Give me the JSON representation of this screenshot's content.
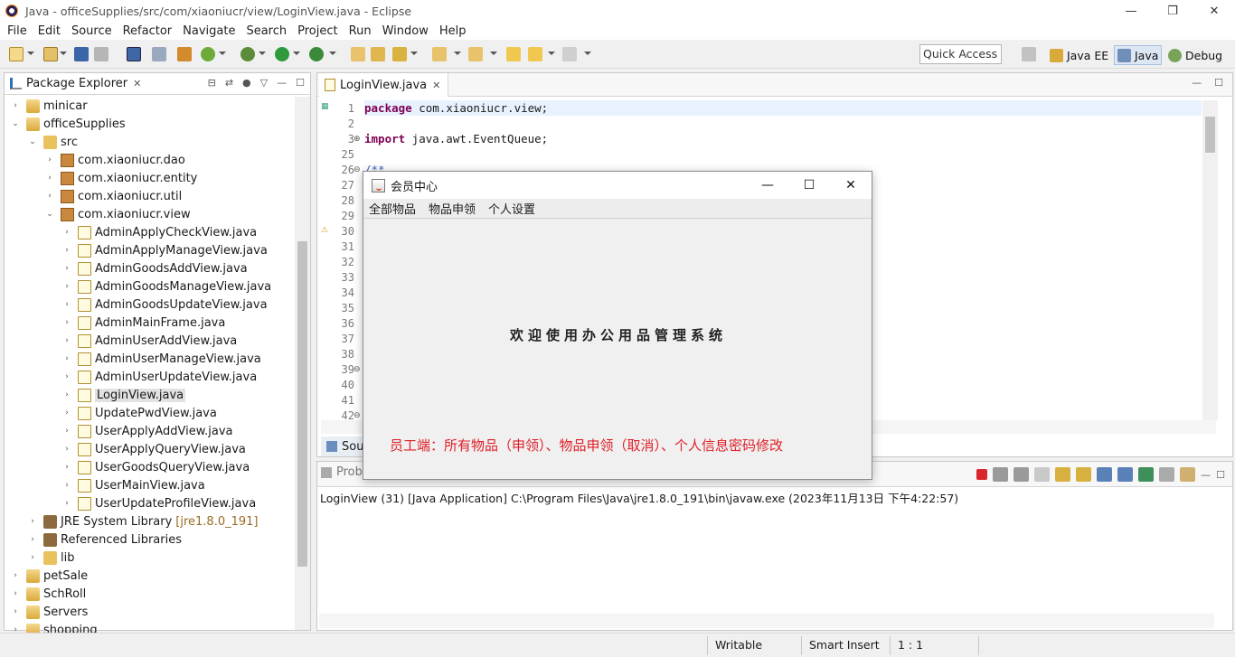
{
  "window": {
    "title": "Java - officeSupplies/src/com/xiaoniucr/view/LoginView.java - Eclipse",
    "minimize": "—",
    "restore": "❐",
    "close": "✕"
  },
  "menu": [
    "File",
    "Edit",
    "Source",
    "Refactor",
    "Navigate",
    "Search",
    "Project",
    "Run",
    "Window",
    "Help"
  ],
  "quick_access": "Quick Access",
  "perspectives": [
    {
      "label": "Java EE",
      "active": false
    },
    {
      "label": "Java",
      "active": true
    },
    {
      "label": "Debug",
      "active": false
    }
  ],
  "package_explorer": {
    "tab_label": "Package Explorer",
    "tree": [
      {
        "label": "minicar",
        "type": "project",
        "level": 0,
        "expanded": false
      },
      {
        "label": "officeSupplies",
        "type": "project",
        "level": 0,
        "expanded": true
      },
      {
        "label": "src",
        "type": "folder",
        "level": 1,
        "expanded": true
      },
      {
        "label": "com.xiaoniucr.dao",
        "type": "pkg",
        "level": 2,
        "expanded": false
      },
      {
        "label": "com.xiaoniucr.entity",
        "type": "pkg",
        "level": 2,
        "expanded": false
      },
      {
        "label": "com.xiaoniucr.util",
        "type": "pkg",
        "level": 2,
        "expanded": false
      },
      {
        "label": "com.xiaoniucr.view",
        "type": "pkg",
        "level": 2,
        "expanded": true
      },
      {
        "label": "AdminApplyCheckView.java",
        "type": "java",
        "level": 3,
        "expanded": false
      },
      {
        "label": "AdminApplyManageView.java",
        "type": "java",
        "level": 3,
        "expanded": false
      },
      {
        "label": "AdminGoodsAddView.java",
        "type": "java",
        "level": 3,
        "expanded": false
      },
      {
        "label": "AdminGoodsManageView.java",
        "type": "java",
        "level": 3,
        "expanded": false
      },
      {
        "label": "AdminGoodsUpdateView.java",
        "type": "java",
        "level": 3,
        "expanded": false
      },
      {
        "label": "AdminMainFrame.java",
        "type": "java",
        "level": 3,
        "expanded": false
      },
      {
        "label": "AdminUserAddView.java",
        "type": "java",
        "level": 3,
        "expanded": false
      },
      {
        "label": "AdminUserManageView.java",
        "type": "java",
        "level": 3,
        "expanded": false
      },
      {
        "label": "AdminUserUpdateView.java",
        "type": "java",
        "level": 3,
        "expanded": false
      },
      {
        "label": "LoginView.java",
        "type": "java",
        "level": 3,
        "expanded": false,
        "selected": true
      },
      {
        "label": "UpdatePwdView.java",
        "type": "java",
        "level": 3,
        "expanded": false
      },
      {
        "label": "UserApplyAddView.java",
        "type": "java",
        "level": 3,
        "expanded": false
      },
      {
        "label": "UserApplyQueryView.java",
        "type": "java",
        "level": 3,
        "expanded": false
      },
      {
        "label": "UserGoodsQueryView.java",
        "type": "java",
        "level": 3,
        "expanded": false
      },
      {
        "label": "UserMainView.java",
        "type": "java",
        "level": 3,
        "expanded": false
      },
      {
        "label": "UserUpdateProfileView.java",
        "type": "java",
        "level": 3,
        "expanded": false
      },
      {
        "label": "JRE System Library",
        "sub": "[jre1.8.0_191]",
        "type": "lib",
        "level": 1,
        "expanded": false
      },
      {
        "label": "Referenced Libraries",
        "type": "lib",
        "level": 1,
        "expanded": false
      },
      {
        "label": "lib",
        "type": "folder",
        "level": 1,
        "expanded": false
      },
      {
        "label": "petSale",
        "type": "project",
        "level": 0,
        "expanded": false
      },
      {
        "label": "SchRoll",
        "type": "project",
        "level": 0,
        "expanded": false
      },
      {
        "label": "Servers",
        "type": "project",
        "level": 0,
        "expanded": false
      },
      {
        "label": "shopping",
        "type": "project",
        "level": 0,
        "expanded": false
      }
    ]
  },
  "editor": {
    "tab_label": "LoginView.java",
    "bottom_tab": "Sour",
    "lines": [
      {
        "num": "1",
        "kw": "package",
        "text": " com.xiaoniucr.view;"
      },
      {
        "num": "2",
        "kw": "",
        "text": ""
      },
      {
        "num": "3",
        "kw": "import",
        "text": " java.awt.EventQueue;"
      },
      {
        "num": "25",
        "kw": "",
        "text": ""
      },
      {
        "num": "26",
        "kw": "",
        "comment": "/**",
        "text": ""
      },
      {
        "num": "27",
        "kw": "",
        "text": ""
      },
      {
        "num": "28",
        "kw": "",
        "text": ""
      },
      {
        "num": "29",
        "kw": "",
        "text": ""
      },
      {
        "num": "30",
        "kw": "",
        "text": ""
      },
      {
        "num": "31",
        "kw": "",
        "text": ""
      },
      {
        "num": "32",
        "kw": "",
        "text": ""
      },
      {
        "num": "33",
        "kw": "",
        "text": ""
      },
      {
        "num": "34",
        "kw": "",
        "text": ""
      },
      {
        "num": "35",
        "kw": "",
        "text": ""
      },
      {
        "num": "36",
        "kw": "",
        "text": ""
      },
      {
        "num": "37",
        "kw": "",
        "text": ""
      },
      {
        "num": "38",
        "kw": "",
        "text": ""
      },
      {
        "num": "39",
        "kw": "",
        "text": ""
      },
      {
        "num": "40",
        "kw": "",
        "text": ""
      },
      {
        "num": "41",
        "kw": "",
        "text": ""
      },
      {
        "num": "42",
        "kw": "",
        "text": ""
      }
    ]
  },
  "console": {
    "tab_label": "Prob",
    "line": "LoginView (31) [Java Application] C:\\Program Files\\Java\\jre1.8.0_191\\bin\\javaw.exe (2023年11月13日 下午4:22:57)"
  },
  "status": {
    "writable": "Writable",
    "insert": "Smart Insert",
    "position": "1 : 1"
  },
  "swing_window": {
    "title": "会员中心",
    "menus": [
      "全部物品",
      "物品申领",
      "个人设置"
    ],
    "welcome": "欢迎使用办公用品管理系统",
    "note": "员工端：所有物品（申领）、物品申领（取消）、个人信息密码修改",
    "minimize": "—",
    "maximize": "☐",
    "close": "✕"
  }
}
